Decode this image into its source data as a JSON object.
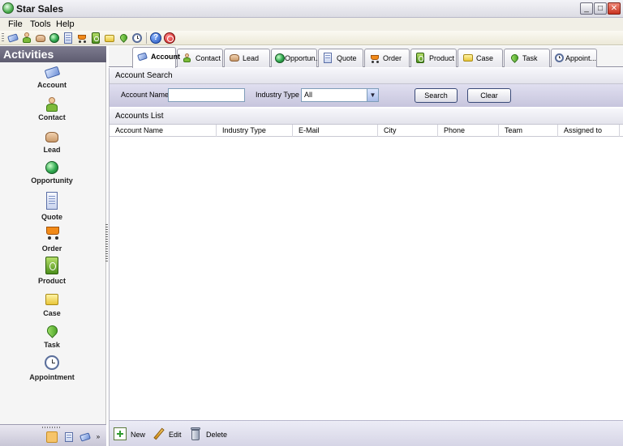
{
  "window": {
    "title": "Star Sales",
    "controls": {
      "minimize": "_",
      "maximize": "□",
      "close": "✕"
    }
  },
  "menu": [
    "File",
    "Tools",
    "Help"
  ],
  "toolbar": {
    "icons": [
      "account-icon",
      "contact-icon",
      "lead-icon",
      "opportunity-icon",
      "quote-icon",
      "order-icon",
      "product-icon",
      "case-icon",
      "task-icon",
      "appointment-icon",
      "help-icon",
      "exit-icon"
    ],
    "help_glyph": "?"
  },
  "sidebar": {
    "header": "Activities",
    "items": [
      {
        "label": "Account",
        "icon": "account-icon"
      },
      {
        "label": "Contact",
        "icon": "contact-icon"
      },
      {
        "label": "Lead",
        "icon": "lead-icon"
      },
      {
        "label": "Opportunity",
        "icon": "opportunity-icon"
      },
      {
        "label": "Quote",
        "icon": "quote-icon"
      },
      {
        "label": "Order",
        "icon": "order-icon"
      },
      {
        "label": "Product",
        "icon": "product-icon"
      },
      {
        "label": "Case",
        "icon": "case-icon"
      },
      {
        "label": "Task",
        "icon": "task-icon"
      },
      {
        "label": "Appointment",
        "icon": "appointment-icon"
      }
    ]
  },
  "tabs": [
    {
      "label": "Account",
      "active": true
    },
    {
      "label": "Contact"
    },
    {
      "label": "Lead"
    },
    {
      "label": "Opportun..."
    },
    {
      "label": "Quote"
    },
    {
      "label": "Order"
    },
    {
      "label": "Product"
    },
    {
      "label": "Case"
    },
    {
      "label": "Task"
    },
    {
      "label": "Appoint..."
    }
  ],
  "search": {
    "header": "Account Search",
    "account_name_label": "Account Name",
    "account_name_value": "",
    "industry_type_label": "Industry Type",
    "industry_type_value": "All",
    "search_button": "Search",
    "clear_button": "Clear"
  },
  "list": {
    "header": "Accounts List",
    "columns": [
      "Account Name",
      "Industry Type",
      "E-Mail",
      "City",
      "Phone",
      "Team",
      "Assigned to"
    ],
    "rows": []
  },
  "actions": {
    "new": "New",
    "edit": "Edit",
    "delete": "Delete"
  },
  "colors": {
    "sidebar_header": "#6e6c80",
    "search_band": "#d3d1e7",
    "accent": "#3a4a78"
  }
}
